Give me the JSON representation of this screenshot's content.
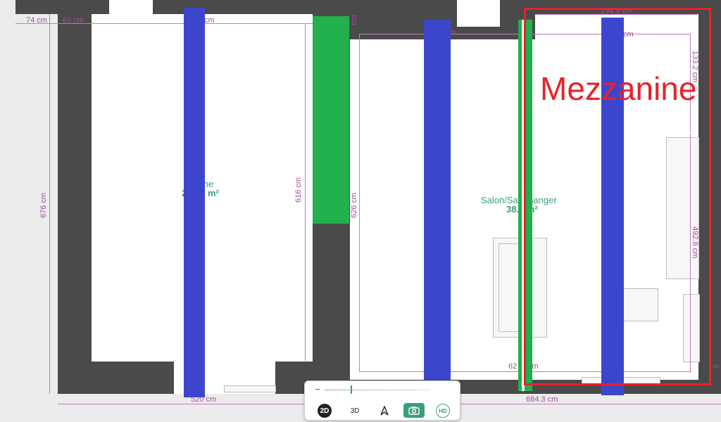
{
  "dimensions": {
    "d74": "74 cm",
    "d60": "60 cm",
    "d676": "676 cm",
    "d616": "616 cm",
    "d626": "626 cm",
    "d520": "520 cm",
    "d6843": "684.3 cm",
    "d2945": "294.5 cm",
    "d1332": "133.2 cm",
    "d4928": "492.8 cm",
    "d62": "62",
    "d62cm": "cm",
    "top_partial_cm": "cm",
    "top_partial_m": "m",
    "side_partial": "62 cm",
    "right_partial": "5"
  },
  "rooms": {
    "left_label": "ine",
    "left_area": "m²",
    "left_area_prefix": "2",
    "salon_label": "Salon/Sa   manger",
    "salon_area": "38.   m²"
  },
  "annotation": {
    "mezzanine": "Mezzanine",
    "color": "#e8222a"
  },
  "toolbar": {
    "zoom_minus": "−",
    "btn_2d": "2D",
    "btn_3d": "3D",
    "btn_hd": "HD"
  },
  "colors": {
    "wall": "#4a4a4a",
    "dimension": "#a0509a",
    "room_text": "#3aa07a",
    "blue_marker": "#3c46cc",
    "green_marker": "#22b04c",
    "accent": "#3aa07a"
  }
}
